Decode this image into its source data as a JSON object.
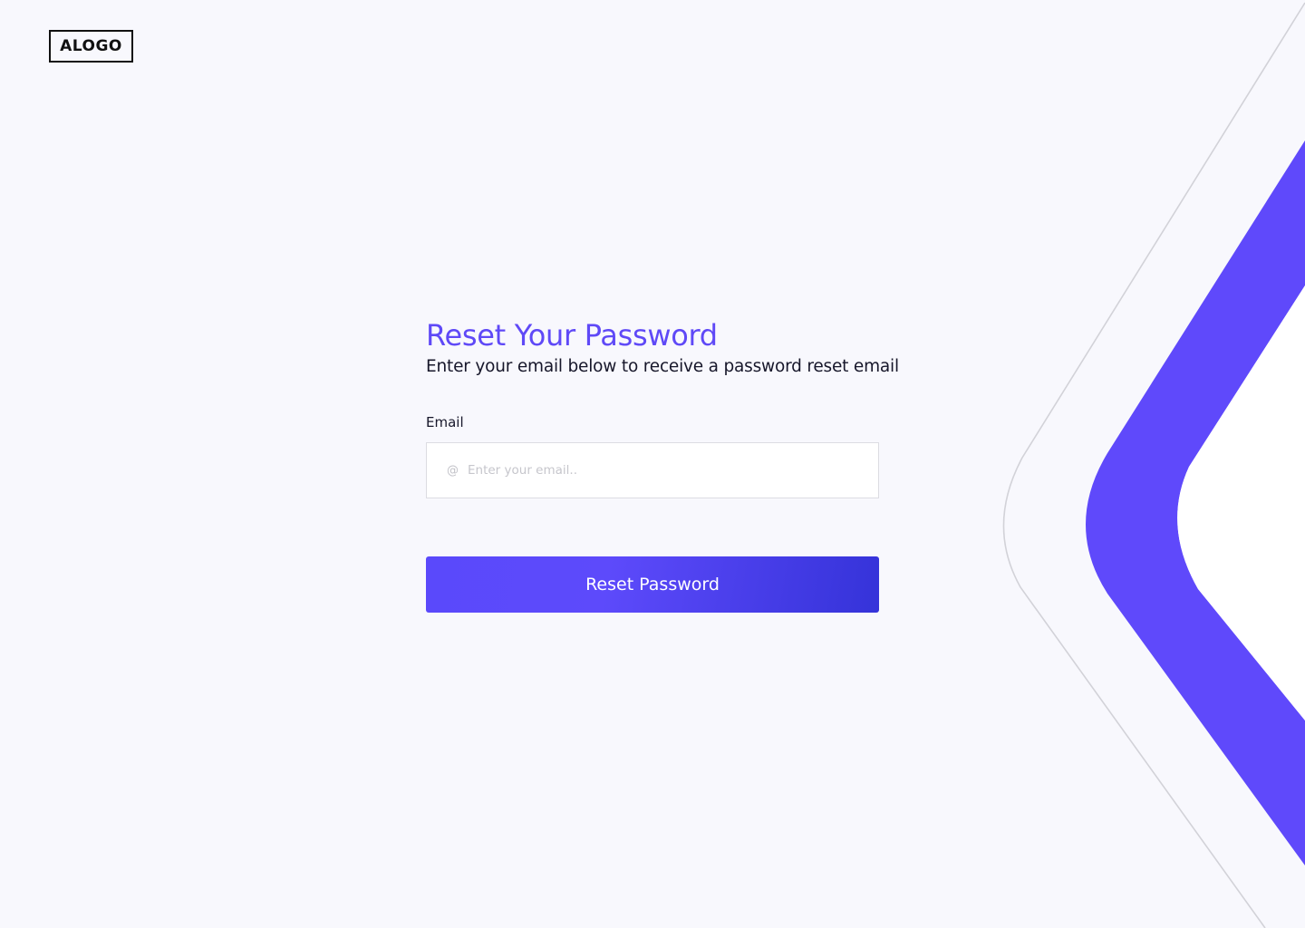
{
  "brand": {
    "logo_text": "ALOGO"
  },
  "form": {
    "title": "Reset Your Password",
    "subtitle": "Enter your email below to receive a password reset email",
    "email_label": "Email",
    "email_placeholder": "Enter your email..",
    "email_value": "",
    "email_icon": "at-icon",
    "submit_label": "Reset Password"
  },
  "colors": {
    "accent": "#5f49f7",
    "button_gradient_start": "#5d4afb",
    "button_gradient_end": "#3533d9",
    "background": "#f8f8fd",
    "text": "#17172a"
  }
}
